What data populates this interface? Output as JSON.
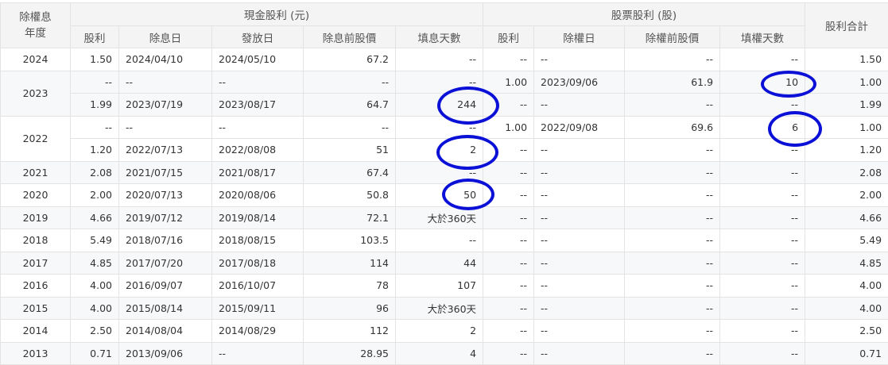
{
  "headers": {
    "year": "除權息\n年度",
    "cash_group": "現金股利 (元)",
    "stock_group": "股票股利 (股)",
    "total": "股利合計",
    "cash_cols": [
      "股利",
      "除息日",
      "發放日",
      "除息前股價",
      "填息天數"
    ],
    "stock_cols": [
      "股利",
      "除權日",
      "除權前股價",
      "填權天數"
    ]
  },
  "years": [
    {
      "year": "2024",
      "rows": [
        [
          "1.50",
          "2024/04/10",
          "2024/05/10",
          "67.2",
          "--",
          "--",
          "--",
          "--",
          "--",
          "1.50"
        ]
      ]
    },
    {
      "year": "2023",
      "rows": [
        [
          "--",
          "--",
          "--",
          "--",
          "--",
          "1.00",
          "2023/09/06",
          "61.9",
          "10",
          "1.00"
        ],
        [
          "1.99",
          "2023/07/19",
          "2023/08/17",
          "64.7",
          "244",
          "--",
          "--",
          "--",
          "--",
          "1.99"
        ]
      ]
    },
    {
      "year": "2022",
      "rows": [
        [
          "--",
          "--",
          "--",
          "--",
          "--",
          "1.00",
          "2022/09/08",
          "69.6",
          "6",
          "1.00"
        ],
        [
          "1.20",
          "2022/07/13",
          "2022/08/08",
          "51",
          "2",
          "--",
          "--",
          "--",
          "--",
          "1.20"
        ]
      ]
    },
    {
      "year": "2021",
      "rows": [
        [
          "2.08",
          "2021/07/15",
          "2021/08/17",
          "67.4",
          "--",
          "--",
          "--",
          "--",
          "--",
          "2.08"
        ]
      ]
    },
    {
      "year": "2020",
      "rows": [
        [
          "2.00",
          "2020/07/13",
          "2020/08/06",
          "50.8",
          "50",
          "--",
          "--",
          "--",
          "--",
          "2.00"
        ]
      ]
    },
    {
      "year": "2019",
      "rows": [
        [
          "4.66",
          "2019/07/12",
          "2019/08/14",
          "72.1",
          "大於360天",
          "--",
          "--",
          "--",
          "--",
          "4.66"
        ]
      ]
    },
    {
      "year": "2018",
      "rows": [
        [
          "5.49",
          "2018/07/16",
          "2018/08/15",
          "103.5",
          "--",
          "--",
          "--",
          "--",
          "--",
          "5.49"
        ]
      ]
    },
    {
      "year": "2017",
      "rows": [
        [
          "4.85",
          "2017/07/20",
          "2017/08/18",
          "114",
          "44",
          "--",
          "--",
          "--",
          "--",
          "4.85"
        ]
      ]
    },
    {
      "year": "2016",
      "rows": [
        [
          "4.00",
          "2016/09/07",
          "2016/10/07",
          "78",
          "107",
          "--",
          "--",
          "--",
          "--",
          "4.00"
        ]
      ]
    },
    {
      "year": "2015",
      "rows": [
        [
          "4.00",
          "2015/08/14",
          "2015/09/11",
          "96",
          "大於360天",
          "--",
          "--",
          "--",
          "--",
          "4.00"
        ]
      ]
    },
    {
      "year": "2014",
      "rows": [
        [
          "2.50",
          "2014/08/04",
          "2014/08/29",
          "112",
          "2",
          "--",
          "--",
          "--",
          "--",
          "2.50"
        ]
      ]
    },
    {
      "year": "2013",
      "rows": [
        [
          "0.71",
          "2013/09/06",
          "--",
          "28.95",
          "4",
          "--",
          "--",
          "--",
          "--",
          "0.71"
        ]
      ]
    }
  ],
  "colors": {
    "annotation_circle": "#0b10d6",
    "header_bg": "#f4f4f4",
    "row_shade": "#f7f8fa"
  }
}
